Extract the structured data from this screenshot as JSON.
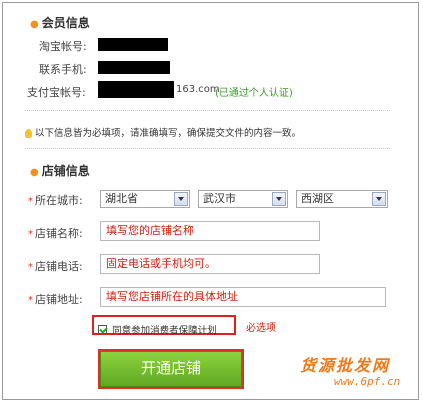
{
  "member": {
    "title": "会员信息",
    "taobao_label": "淘宝帐号:",
    "phone_label": "联系手机:",
    "alipay_label": "支付宝帐号:",
    "alipay_suffix": "163.com",
    "verified_text": "(已通过个人认证)"
  },
  "notice": "以下信息皆为必填项，请准确填写，确保提交文件的内容一致。",
  "shop": {
    "title": "店铺信息",
    "city_label": "所在城市:",
    "province": "湖北省",
    "city": "武汉市",
    "district": "西湖区",
    "name_label": "店铺名称:",
    "name_value": "填写您的店铺名称",
    "phone_label": "店铺电话:",
    "phone_value": "固定电话或手机均可。",
    "address_label": "店铺地址:",
    "address_value": "填写您店铺所在的具体地址",
    "agree_text": "同意参加消费者保障计划",
    "agree_checked": true,
    "required_note": "必选项",
    "submit_label": "开通店铺"
  },
  "watermark": {
    "title": "货源批发网",
    "url": "www.6pf.cn"
  },
  "colors": {
    "required": "#d02010",
    "verified": "#3a9a2a",
    "button": "#6cb52a",
    "highlight_border": "#e02020"
  }
}
